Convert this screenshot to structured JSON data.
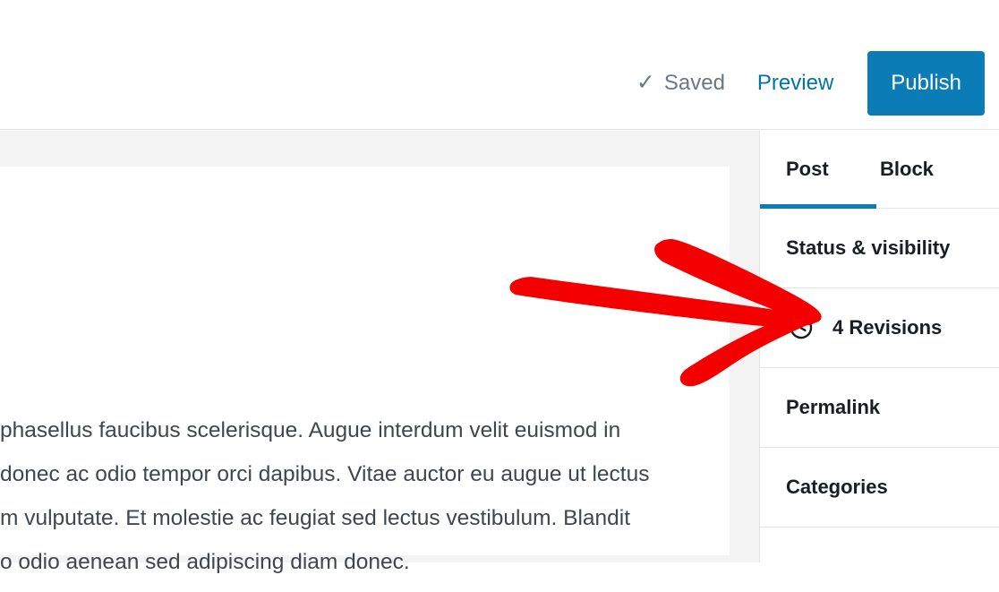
{
  "topbar": {
    "saved_label": "Saved",
    "saved_check_glyph": "✓",
    "preview_label": "Preview",
    "publish_label": "Publish",
    "publish_color": "#0b7cb5",
    "preview_color": "#0073aa",
    "saved_color": "#6c7781"
  },
  "editor": {
    "content_lines": [
      "phasellus faucibus scelerisque. Augue interdum velit euismod in",
      "donec ac odio tempor orci dapibus. Vitae auctor eu augue ut lectus",
      "m vulputate. Et molestie ac feugiat sed lectus vestibulum. Blandit",
      "o odio aenean sed adipiscing diam donec."
    ]
  },
  "sidebar": {
    "tabs": [
      {
        "label": "Post",
        "active": true
      },
      {
        "label": "Block",
        "active": false
      }
    ],
    "active_tab_underline_color": "#0b7cb5",
    "panels": [
      {
        "label": "Status & visibility",
        "icon": null
      },
      {
        "label": "4 Revisions",
        "icon": "revisions-clock-icon"
      },
      {
        "label": "Permalink",
        "icon": null
      },
      {
        "label": "Categories",
        "icon": null
      }
    ]
  },
  "annotation": {
    "type": "arrow",
    "color": "#f40000",
    "points_to": "4 Revisions"
  }
}
